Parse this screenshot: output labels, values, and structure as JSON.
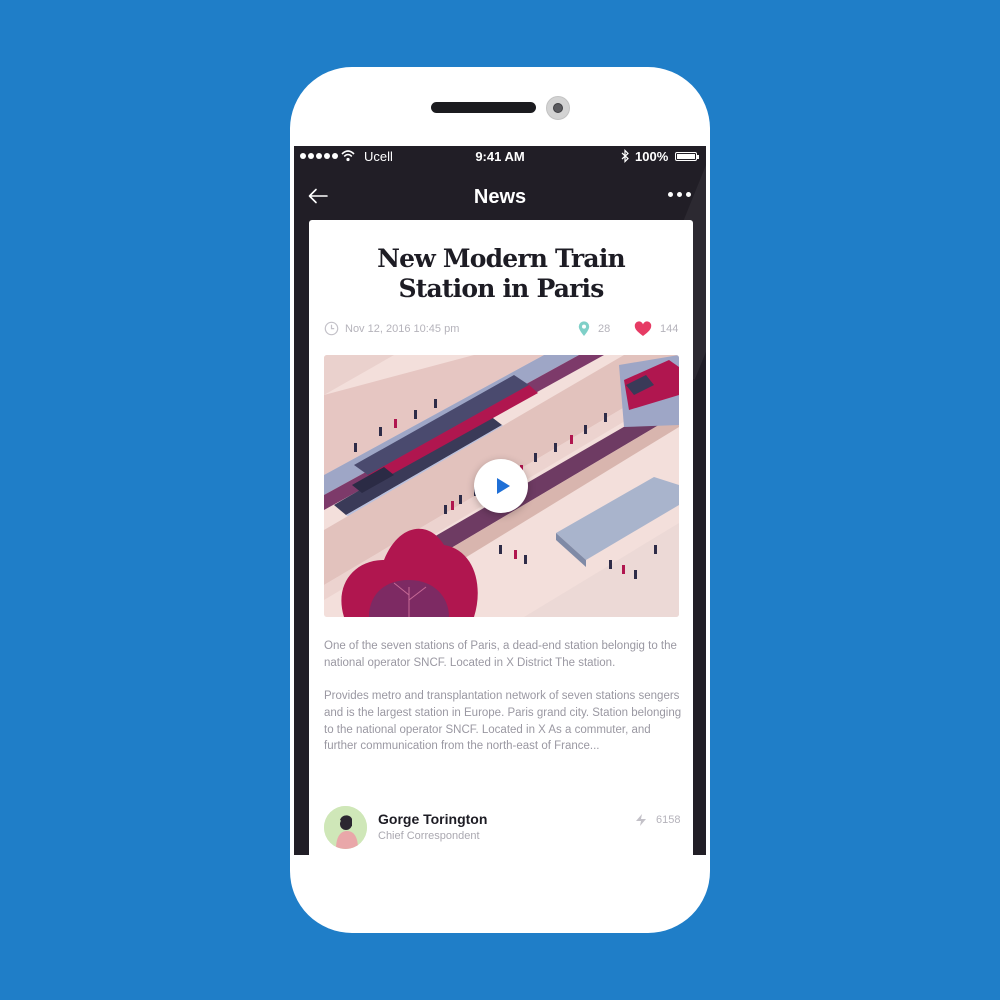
{
  "status_bar": {
    "carrier": "Ucell",
    "time": "9:41 AM",
    "battery": "100%"
  },
  "nav": {
    "title": "News"
  },
  "article": {
    "title_line1": "New Modern Train",
    "title_line2": "Station in Paris",
    "date": "Nov 12, 2016 10:45 pm",
    "location_count": "28",
    "likes": "144",
    "paragraph1": "One of the seven stations of Paris, a dead-end station belongig to the national operator SNCF. Located in X District The station.",
    "paragraph2": "Provides metro and transplantation network of seven stations sengers and is the largest station in Europe. Paris grand city. Station belonging to the national operator SNCF. Located in X As a commuter, and further communication from the north-east of France..."
  },
  "author": {
    "name": "Gorge Torington",
    "role": "Chief Correspondent",
    "shares": "6158"
  },
  "colors": {
    "background": "#1f7ec8",
    "screen": "#211e26",
    "heart": "#e63b64",
    "pin": "#7fd0c8",
    "play": "#1f6fd6"
  },
  "icons": [
    "back-arrow-icon",
    "more-icon",
    "clock-icon",
    "location-pin-icon",
    "heart-icon",
    "play-icon",
    "share-icon",
    "wifi-icon",
    "bluetooth-icon",
    "battery-icon"
  ]
}
